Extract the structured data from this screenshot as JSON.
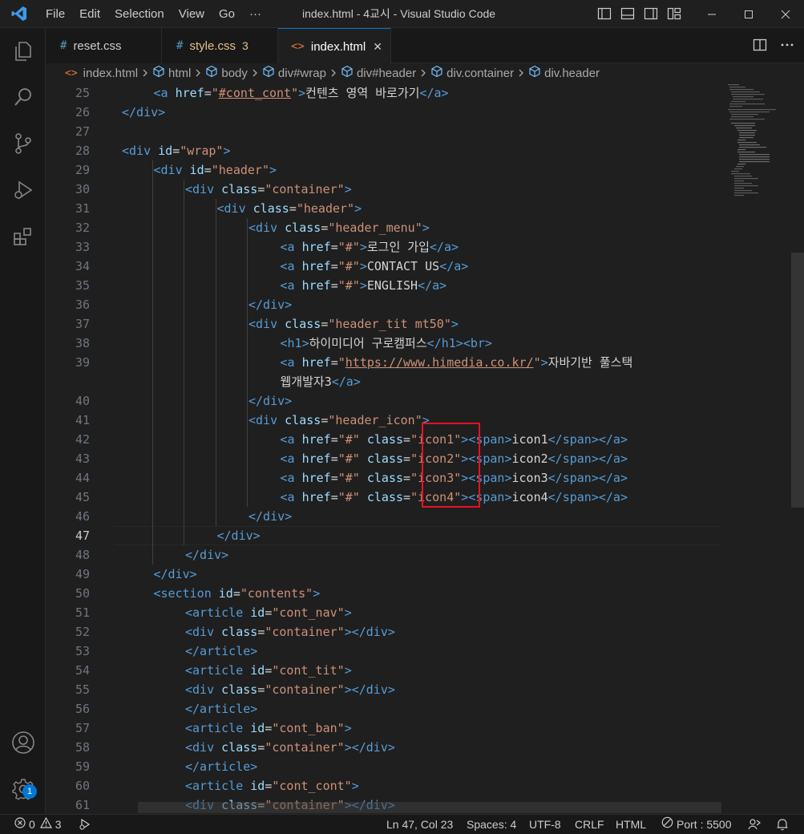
{
  "window": {
    "title": "index.html - 4교시 - Visual Studio Code"
  },
  "menu": {
    "items": [
      "File",
      "Edit",
      "Selection",
      "View",
      "Go",
      "···"
    ]
  },
  "tabs": [
    {
      "label": "reset.css",
      "icon": "#",
      "icon_color": "#519aba",
      "label_color": "#cccccc",
      "badge": "",
      "active": false
    },
    {
      "label": "style.css",
      "icon": "#",
      "icon_color": "#519aba",
      "label_color": "#e2c08d",
      "badge": "3",
      "active": false
    },
    {
      "label": "index.html",
      "icon": "<>",
      "icon_color": "#e37933",
      "label_color": "#ffffff",
      "badge": "",
      "active": true,
      "close": "✕"
    }
  ],
  "breadcrumb": [
    "index.html",
    "html",
    "body",
    "div#wrap",
    "div#header",
    "div.container",
    "div.header"
  ],
  "editor": {
    "current_line": 47,
    "lines": [
      {
        "n": 25,
        "tokens": [
          [
            "tag",
            "<a "
          ],
          [
            "attr",
            "href"
          ],
          [
            "eq",
            "="
          ],
          [
            "str",
            "\""
          ],
          [
            "stru",
            "#cont_cont"
          ],
          [
            "str",
            "\""
          ],
          [
            "tag",
            ">"
          ],
          [
            "txt",
            "컨텐츠 영역 바로가기"
          ],
          [
            "tag",
            "</a>"
          ]
        ],
        "indent": 1
      },
      {
        "n": 26,
        "tokens": [
          [
            "tag",
            "</div>"
          ]
        ],
        "indent": 0
      },
      {
        "n": 27,
        "tokens": [],
        "indent": 0
      },
      {
        "n": 28,
        "tokens": [
          [
            "tag",
            "<div "
          ],
          [
            "attr",
            "id"
          ],
          [
            "eq",
            "="
          ],
          [
            "str",
            "\"wrap\""
          ],
          [
            "tag",
            ">"
          ]
        ],
        "indent": 0
      },
      {
        "n": 29,
        "tokens": [
          [
            "tag",
            "<div "
          ],
          [
            "attr",
            "id"
          ],
          [
            "eq",
            "="
          ],
          [
            "str",
            "\"header\""
          ],
          [
            "tag",
            ">"
          ]
        ],
        "indent": 1
      },
      {
        "n": 30,
        "tokens": [
          [
            "tag",
            "<div "
          ],
          [
            "attr",
            "class"
          ],
          [
            "eq",
            "="
          ],
          [
            "str",
            "\"container\""
          ],
          [
            "tag",
            ">"
          ]
        ],
        "indent": 2
      },
      {
        "n": 31,
        "tokens": [
          [
            "tag",
            "<div "
          ],
          [
            "attr",
            "class"
          ],
          [
            "eq",
            "="
          ],
          [
            "str",
            "\"header\""
          ],
          [
            "tag",
            ">"
          ]
        ],
        "indent": 3
      },
      {
        "n": 32,
        "tokens": [
          [
            "tag",
            "<div "
          ],
          [
            "attr",
            "class"
          ],
          [
            "eq",
            "="
          ],
          [
            "str",
            "\"header_menu\""
          ],
          [
            "tag",
            ">"
          ]
        ],
        "indent": 4
      },
      {
        "n": 33,
        "tokens": [
          [
            "tag",
            "<a "
          ],
          [
            "attr",
            "href"
          ],
          [
            "eq",
            "="
          ],
          [
            "str",
            "\"#\""
          ],
          [
            "tag",
            ">"
          ],
          [
            "txt",
            "로그인 가입"
          ],
          [
            "tag",
            "</a>"
          ]
        ],
        "indent": 5
      },
      {
        "n": 34,
        "tokens": [
          [
            "tag",
            "<a "
          ],
          [
            "attr",
            "href"
          ],
          [
            "eq",
            "="
          ],
          [
            "str",
            "\"#\""
          ],
          [
            "tag",
            ">"
          ],
          [
            "txt",
            "CONTACT US"
          ],
          [
            "tag",
            "</a>"
          ]
        ],
        "indent": 5
      },
      {
        "n": 35,
        "tokens": [
          [
            "tag",
            "<a "
          ],
          [
            "attr",
            "href"
          ],
          [
            "eq",
            "="
          ],
          [
            "str",
            "\"#\""
          ],
          [
            "tag",
            ">"
          ],
          [
            "txt",
            "ENGLISH"
          ],
          [
            "tag",
            "</a>"
          ]
        ],
        "indent": 5
      },
      {
        "n": 36,
        "tokens": [
          [
            "tag",
            "</div>"
          ]
        ],
        "indent": 4
      },
      {
        "n": 37,
        "tokens": [
          [
            "tag",
            "<div "
          ],
          [
            "attr",
            "class"
          ],
          [
            "eq",
            "="
          ],
          [
            "str",
            "\"header_tit mt50\""
          ],
          [
            "tag",
            ">"
          ]
        ],
        "indent": 4
      },
      {
        "n": 38,
        "tokens": [
          [
            "tag",
            "<h1>"
          ],
          [
            "txt",
            "하이미디어 구로캠퍼스"
          ],
          [
            "tag",
            "</h1><br>"
          ]
        ],
        "indent": 5
      },
      {
        "n": 39,
        "tokens": [
          [
            "tag",
            "<a "
          ],
          [
            "attr",
            "href"
          ],
          [
            "eq",
            "="
          ],
          [
            "str",
            "\""
          ],
          [
            "stru",
            "https://www.himedia.co.kr/"
          ],
          [
            "str",
            "\""
          ],
          [
            "tag",
            ">"
          ],
          [
            "txt",
            "자바기반 풀스택"
          ]
        ],
        "indent": 5
      },
      {
        "n": "",
        "tokens": [
          [
            "txt",
            "웹개발자3"
          ],
          [
            "tag",
            "</a>"
          ]
        ],
        "indent": 5
      },
      {
        "n": 40,
        "tokens": [
          [
            "tag",
            "</div>"
          ]
        ],
        "indent": 4
      },
      {
        "n": 41,
        "tokens": [
          [
            "tag",
            "<div "
          ],
          [
            "attr",
            "class"
          ],
          [
            "eq",
            "="
          ],
          [
            "str",
            "\"header_icon\""
          ],
          [
            "tag",
            ">"
          ]
        ],
        "indent": 4
      },
      {
        "n": 42,
        "tokens": [
          [
            "tag",
            "<a "
          ],
          [
            "attr",
            "href"
          ],
          [
            "eq",
            "="
          ],
          [
            "str",
            "\"#\""
          ],
          [
            "txt",
            " "
          ],
          [
            "attr",
            "class"
          ],
          [
            "eq",
            "="
          ],
          [
            "str",
            "\"icon1\""
          ],
          [
            "tag",
            ">"
          ],
          [
            "tag",
            "<span>"
          ],
          [
            "txt",
            "icon1"
          ],
          [
            "tag",
            "</span></a>"
          ]
        ],
        "indent": 5
      },
      {
        "n": 43,
        "tokens": [
          [
            "tag",
            "<a "
          ],
          [
            "attr",
            "href"
          ],
          [
            "eq",
            "="
          ],
          [
            "str",
            "\"#\""
          ],
          [
            "txt",
            " "
          ],
          [
            "attr",
            "class"
          ],
          [
            "eq",
            "="
          ],
          [
            "str",
            "\"icon2\""
          ],
          [
            "tag",
            ">"
          ],
          [
            "tag",
            "<span>"
          ],
          [
            "txt",
            "icon2"
          ],
          [
            "tag",
            "</span></a>"
          ]
        ],
        "indent": 5
      },
      {
        "n": 44,
        "tokens": [
          [
            "tag",
            "<a "
          ],
          [
            "attr",
            "href"
          ],
          [
            "eq",
            "="
          ],
          [
            "str",
            "\"#\""
          ],
          [
            "txt",
            " "
          ],
          [
            "attr",
            "class"
          ],
          [
            "eq",
            "="
          ],
          [
            "str",
            "\"icon3\""
          ],
          [
            "tag",
            ">"
          ],
          [
            "tag",
            "<span>"
          ],
          [
            "txt",
            "icon3"
          ],
          [
            "tag",
            "</span></a>"
          ]
        ],
        "indent": 5
      },
      {
        "n": 45,
        "tokens": [
          [
            "tag",
            "<a "
          ],
          [
            "attr",
            "href"
          ],
          [
            "eq",
            "="
          ],
          [
            "str",
            "\"#\""
          ],
          [
            "txt",
            " "
          ],
          [
            "attr",
            "class"
          ],
          [
            "eq",
            "="
          ],
          [
            "str",
            "\"icon4\""
          ],
          [
            "tag",
            ">"
          ],
          [
            "tag",
            "<span>"
          ],
          [
            "txt",
            "icon4"
          ],
          [
            "tag",
            "</span></a>"
          ]
        ],
        "indent": 5
      },
      {
        "n": 46,
        "tokens": [
          [
            "tag",
            "</div>"
          ]
        ],
        "indent": 4
      },
      {
        "n": 47,
        "tokens": [
          [
            "tag",
            "</div>"
          ]
        ],
        "indent": 3
      },
      {
        "n": 48,
        "tokens": [
          [
            "tag",
            "</div>"
          ]
        ],
        "indent": 2
      },
      {
        "n": 49,
        "tokens": [
          [
            "tag",
            "</div>"
          ]
        ],
        "indent": 1
      },
      {
        "n": 50,
        "tokens": [
          [
            "tag",
            "<section "
          ],
          [
            "attr",
            "id"
          ],
          [
            "eq",
            "="
          ],
          [
            "str",
            "\"contents\""
          ],
          [
            "tag",
            ">"
          ]
        ],
        "indent": 1
      },
      {
        "n": 51,
        "tokens": [
          [
            "tag",
            "<article "
          ],
          [
            "attr",
            "id"
          ],
          [
            "eq",
            "="
          ],
          [
            "str",
            "\"cont_nav\""
          ],
          [
            "tag",
            ">"
          ]
        ],
        "indent": 2
      },
      {
        "n": 52,
        "tokens": [
          [
            "tag",
            "<div "
          ],
          [
            "attr",
            "class"
          ],
          [
            "eq",
            "="
          ],
          [
            "str",
            "\"container\""
          ],
          [
            "tag",
            ">"
          ],
          [
            "tag",
            "</div>"
          ]
        ],
        "indent": 2
      },
      {
        "n": 53,
        "tokens": [
          [
            "tag",
            "</article>"
          ]
        ],
        "indent": 2
      },
      {
        "n": 54,
        "tokens": [
          [
            "tag",
            "<article "
          ],
          [
            "attr",
            "id"
          ],
          [
            "eq",
            "="
          ],
          [
            "str",
            "\"cont_tit\""
          ],
          [
            "tag",
            ">"
          ]
        ],
        "indent": 2
      },
      {
        "n": 55,
        "tokens": [
          [
            "tag",
            "<div "
          ],
          [
            "attr",
            "class"
          ],
          [
            "eq",
            "="
          ],
          [
            "str",
            "\"container\""
          ],
          [
            "tag",
            ">"
          ],
          [
            "tag",
            "</div>"
          ]
        ],
        "indent": 2
      },
      {
        "n": 56,
        "tokens": [
          [
            "tag",
            "</article>"
          ]
        ],
        "indent": 2
      },
      {
        "n": 57,
        "tokens": [
          [
            "tag",
            "<article "
          ],
          [
            "attr",
            "id"
          ],
          [
            "eq",
            "="
          ],
          [
            "str",
            "\"cont_ban\""
          ],
          [
            "tag",
            ">"
          ]
        ],
        "indent": 2
      },
      {
        "n": 58,
        "tokens": [
          [
            "tag",
            "<div "
          ],
          [
            "attr",
            "class"
          ],
          [
            "eq",
            "="
          ],
          [
            "str",
            "\"container\""
          ],
          [
            "tag",
            ">"
          ],
          [
            "tag",
            "</div>"
          ]
        ],
        "indent": 2
      },
      {
        "n": 59,
        "tokens": [
          [
            "tag",
            "</article>"
          ]
        ],
        "indent": 2
      },
      {
        "n": 60,
        "tokens": [
          [
            "tag",
            "<article "
          ],
          [
            "attr",
            "id"
          ],
          [
            "eq",
            "="
          ],
          [
            "str",
            "\"cont_cont\""
          ],
          [
            "tag",
            ">"
          ]
        ],
        "indent": 2
      },
      {
        "n": 61,
        "tokens": [
          [
            "tag",
            "<div "
          ],
          [
            "attr",
            "class"
          ],
          [
            "eq",
            "="
          ],
          [
            "str",
            "\"container\""
          ],
          [
            "tag",
            ">"
          ],
          [
            "tag",
            "</div>"
          ]
        ],
        "indent": 2
      }
    ]
  },
  "statusbar": {
    "errors": "0",
    "warnings": "3",
    "position": "Ln 47, Col 23",
    "spaces": "Spaces: 4",
    "encoding": "UTF-8",
    "eol": "CRLF",
    "language": "HTML",
    "port": "Port : 5500"
  },
  "activity": {
    "settings_badge": "1"
  },
  "colors": {
    "accent": "#0078d4",
    "highlight_box": "#e81123"
  }
}
